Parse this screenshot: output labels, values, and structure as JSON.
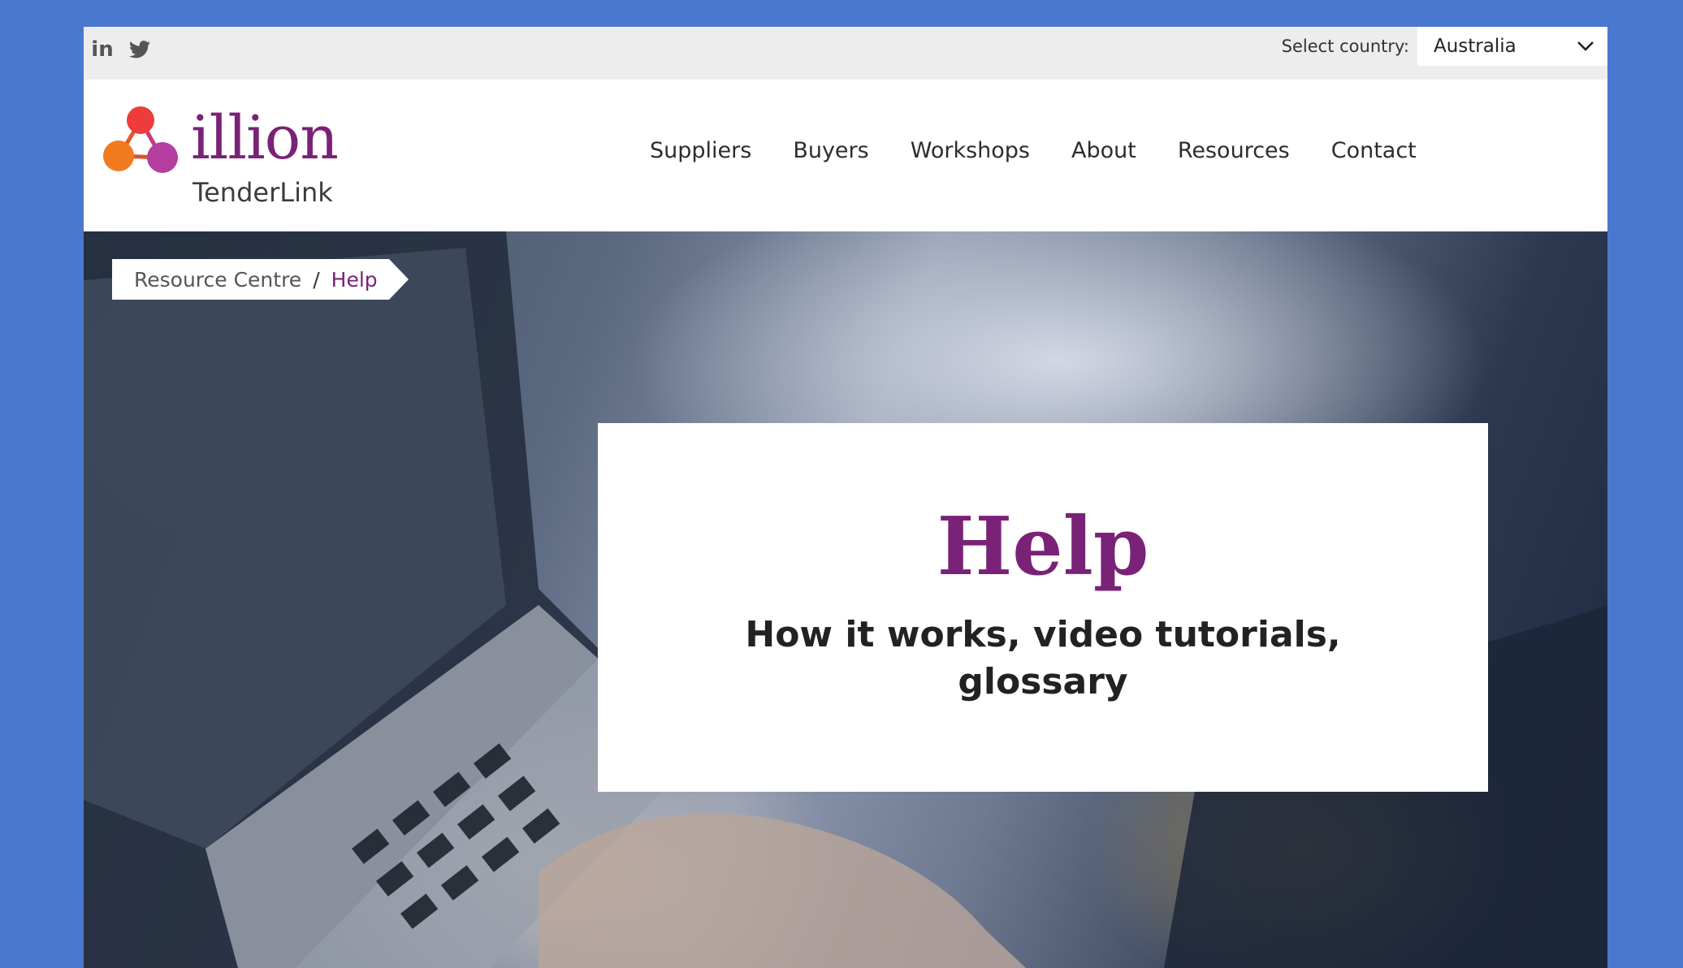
{
  "colors": {
    "brand_purple": "#7a2277",
    "window_border": "#4a78cf",
    "topbar_bg": "#ededed"
  },
  "topbar": {
    "social": [
      {
        "icon": "linkedin-icon",
        "label": "in"
      },
      {
        "icon": "twitter-icon"
      }
    ],
    "country_label": "Select country:",
    "country_value": "Australia"
  },
  "header": {
    "logo_word": "illion",
    "logo_sub": "TenderLink",
    "nav": [
      "Suppliers",
      "Buyers",
      "Workshops",
      "About",
      "Resources",
      "Contact"
    ]
  },
  "breadcrumb": {
    "parent": "Resource Centre",
    "separator": "/",
    "current": "Help"
  },
  "hero": {
    "title": "Help",
    "subtitle": "How it works, video tutorials, glossary"
  }
}
